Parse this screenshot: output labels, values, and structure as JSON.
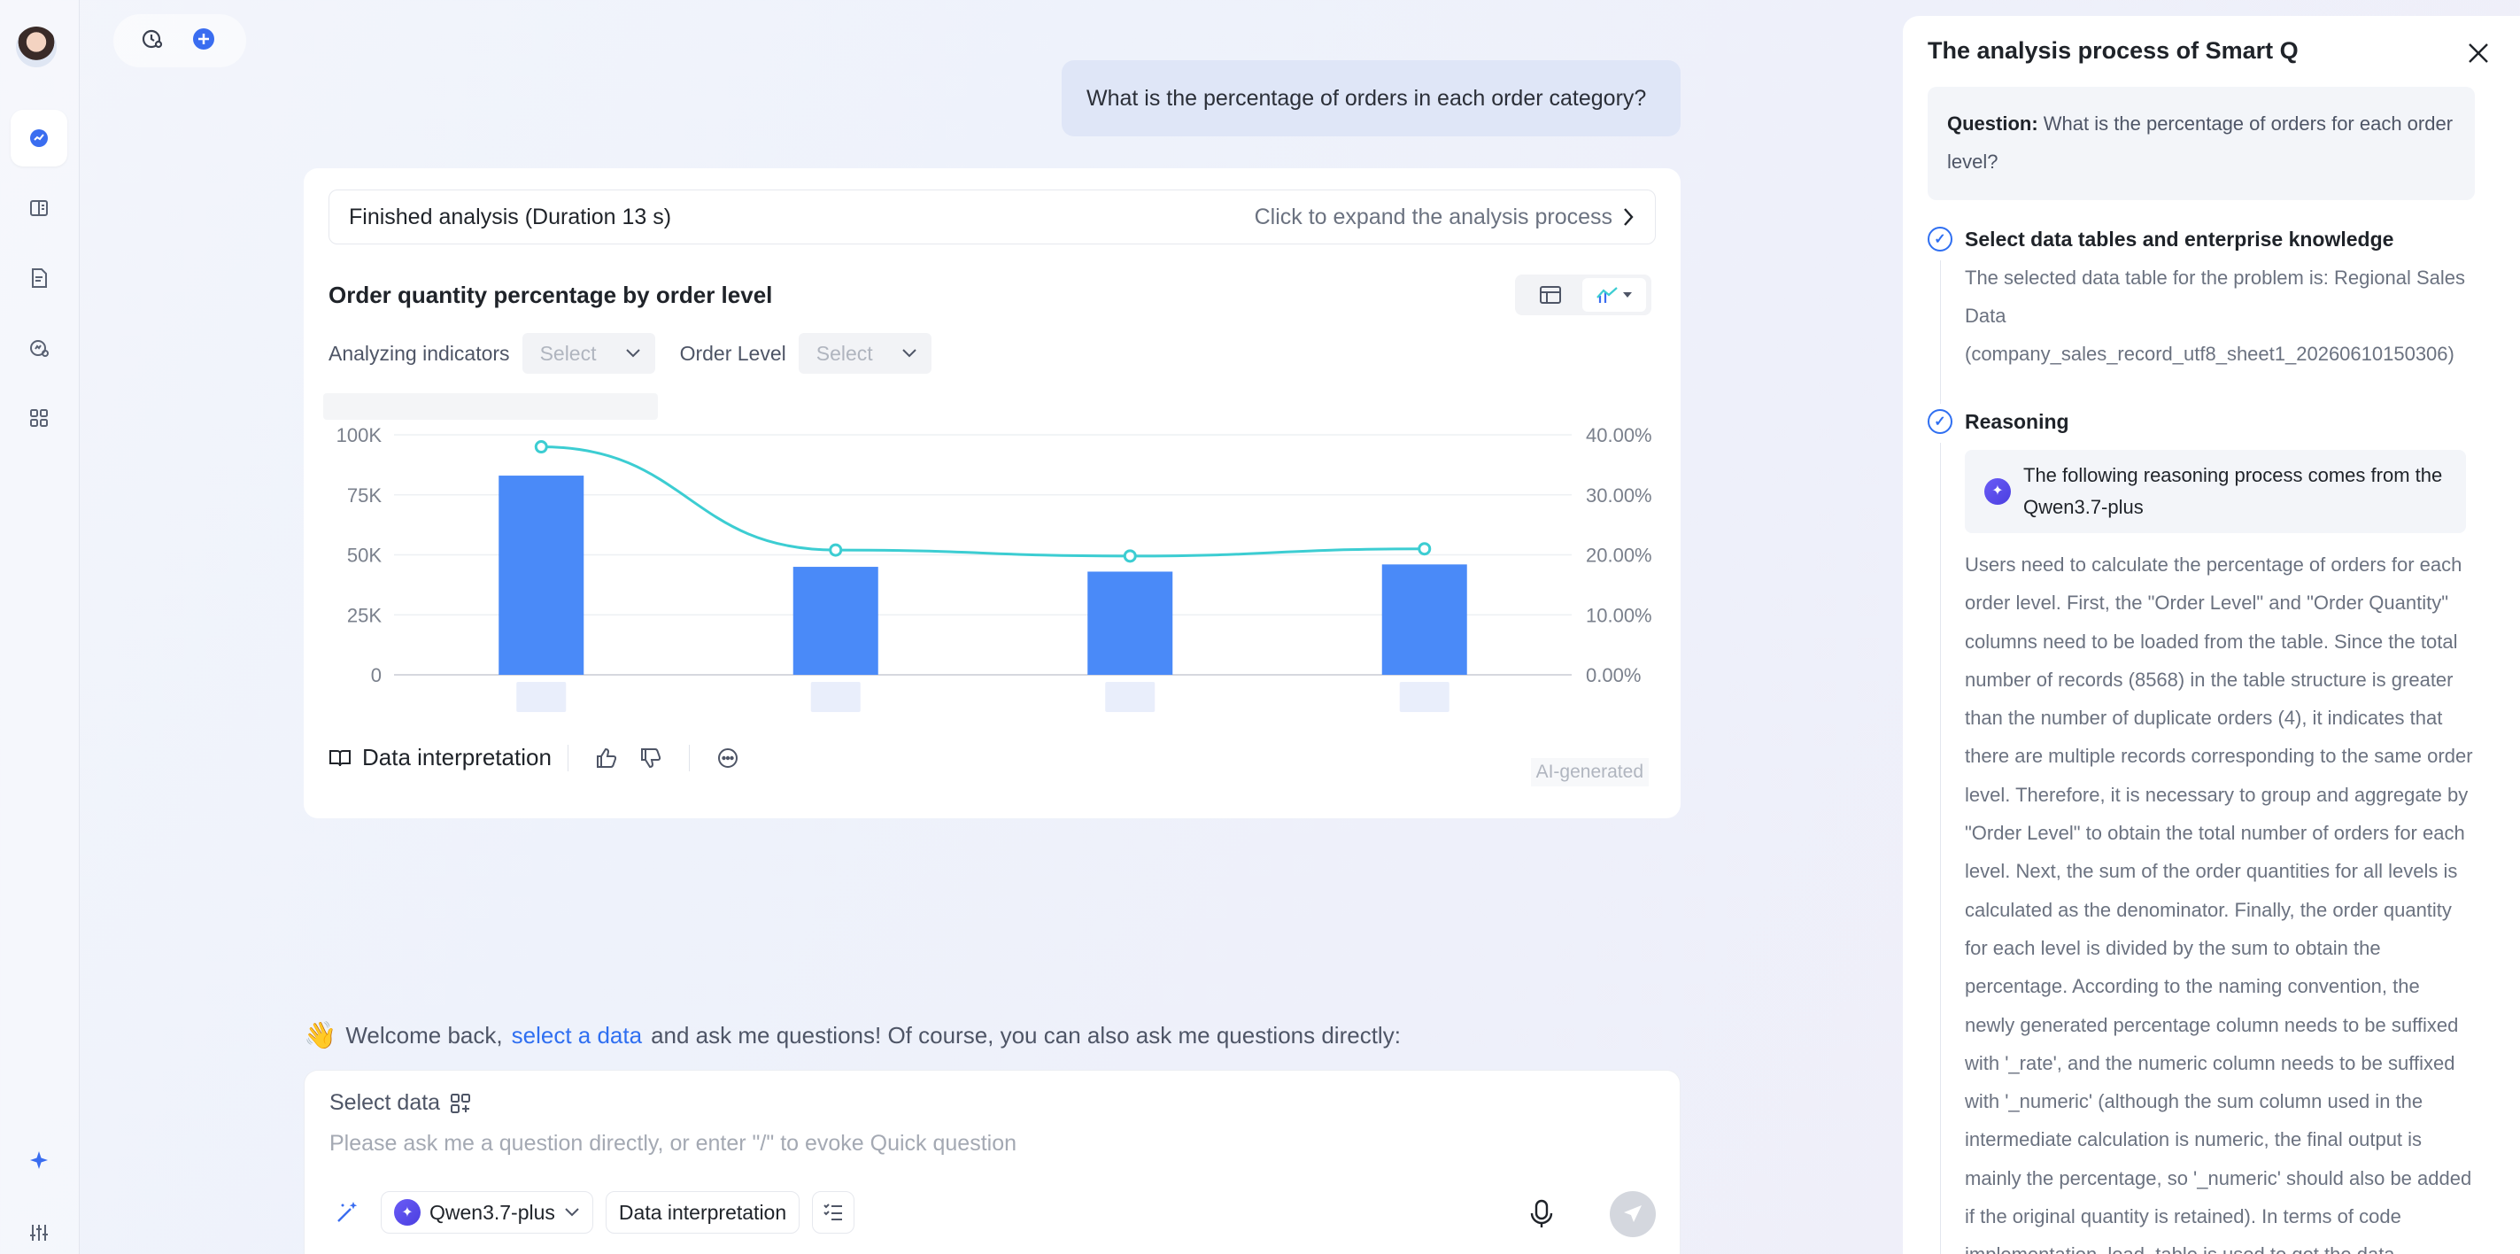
{
  "colors": {
    "accent": "#2f6ff1",
    "bar": "#4a8af8",
    "line": "#3ccdd2",
    "user_bubble": "#dfe6f7"
  },
  "rail": {
    "items": [
      {
        "icon": "chat-analysis-icon",
        "active": true
      },
      {
        "icon": "book-icon"
      },
      {
        "icon": "report-icon"
      },
      {
        "icon": "monitor-icon"
      },
      {
        "icon": "apps-grid-icon"
      }
    ],
    "bottom": [
      {
        "icon": "sparkle-icon"
      },
      {
        "icon": "settings-sliders-icon"
      }
    ]
  },
  "user_message": "What is the percentage of orders in each order category?",
  "card": {
    "finished_label": "Finished analysis (Duration 13 s)",
    "expand_label": "Click to expand the analysis process",
    "chart_title": "Order quantity percentage by order level",
    "filters": [
      {
        "label": "Analyzing indicators",
        "value": "Select"
      },
      {
        "label": "Order Level",
        "value": "Select"
      }
    ],
    "interpretation_label": "Data interpretation",
    "ai_badge": "AI-generated"
  },
  "chart_data": {
    "type": "bar",
    "categories": [
      "",
      "",
      "",
      ""
    ],
    "series": [
      {
        "type": "bar",
        "values": [
          83000,
          45000,
          43000,
          46000
        ],
        "axis": "left"
      },
      {
        "type": "line",
        "values": [
          38.0,
          20.8,
          19.8,
          21.0
        ],
        "axis": "right"
      }
    ],
    "y_ticks": [
      "100K",
      "75K",
      "50K",
      "25K",
      "0"
    ],
    "y_lim": [
      0,
      100000
    ],
    "y2_ticks": [
      "40.00%",
      "30.00%",
      "20.00%",
      "10.00%",
      "0.00%"
    ],
    "y2_lim": [
      0,
      40
    ],
    "grid": true
  },
  "welcome": {
    "prefix": "Welcome back,",
    "link": "select a data",
    "suffix": "and ask me questions! Of course, you can also ask me questions directly:"
  },
  "input": {
    "select_data": "Select data",
    "placeholder": "Please ask me a question directly, or enter \"/\" to evoke Quick question",
    "model": "Qwen3.7-plus",
    "interpretation_chip": "Data interpretation"
  },
  "panel": {
    "title": "The analysis process of Smart Q",
    "question_label": "Question:",
    "question_text": "What is the percentage of orders for each order level?",
    "step1_title": "Select data tables and enterprise knowledge",
    "step1_text": "The selected data table for the problem is: Regional Sales Data (company_sales_record_utf8_sheet1_20260610150306)",
    "step2_title": "Reasoning",
    "model_note": "The following reasoning process comes from the Qwen3.7-plus",
    "reasoning": "Users need to calculate the percentage of orders for each order level. First, the \"Order Level\" and \"Order Quantity\" columns need to be loaded from the table. Since the total number of records (8568) in the table structure is greater than the number of duplicate orders (4), it indicates that there are multiple records corresponding to the same order level. Therefore, it is necessary to group and aggregate by \"Order Level\" to obtain the total number of orders for each level. Next, the sum of the order quantities for all levels is calculated as the denominator. Finally, the order quantity for each level is divided by the sum to obtain the percentage. According to the naming convention, the newly generated percentage column needs to be suffixed with '_rate', and the numeric column needs to be suffixed with '_numeric' (although the sum column used in the intermediate calculation is numeric, the final output is mainly the percentage, so '_numeric' should also be added if the original quantity is retained). In terms of code implementation, load_table is used to get the data, groupby"
  }
}
